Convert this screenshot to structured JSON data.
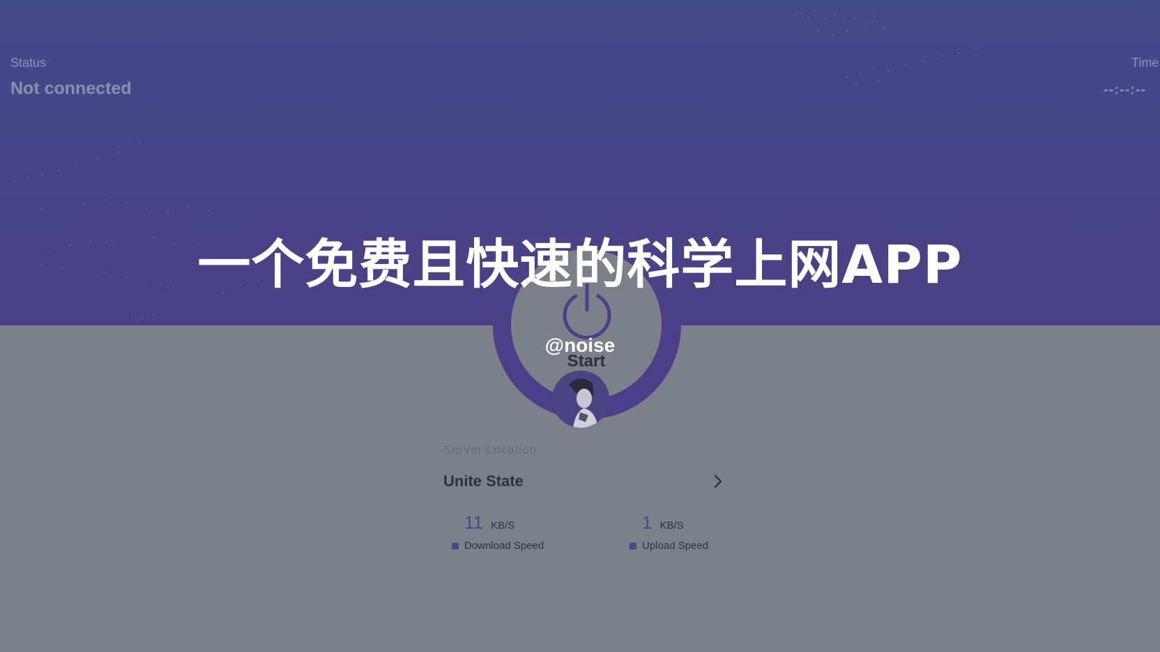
{
  "status": {
    "label": "Status",
    "value": "Not connected"
  },
  "time": {
    "label": "Time",
    "value": "--:--:--"
  },
  "power_button": {
    "label": "Start",
    "icon": "power-icon"
  },
  "overlay": {
    "title": "一个免费且快速的科学上网APP",
    "watermark": "@noise"
  },
  "server": {
    "label": "Server Location",
    "value": "Unite State",
    "icon": "chevron-right-icon"
  },
  "download": {
    "value": "11",
    "unit": "KB/S",
    "label": "Download Speed",
    "icon": "download-icon"
  },
  "upload": {
    "value": "1",
    "unit": "KB/S",
    "label": "Upload Speed",
    "icon": "upload-icon"
  },
  "colors": {
    "header_bg": "#4a4388",
    "body_bg": "#7b8089",
    "accent": "#4c3f8a",
    "text_dark": "#2f323e"
  }
}
